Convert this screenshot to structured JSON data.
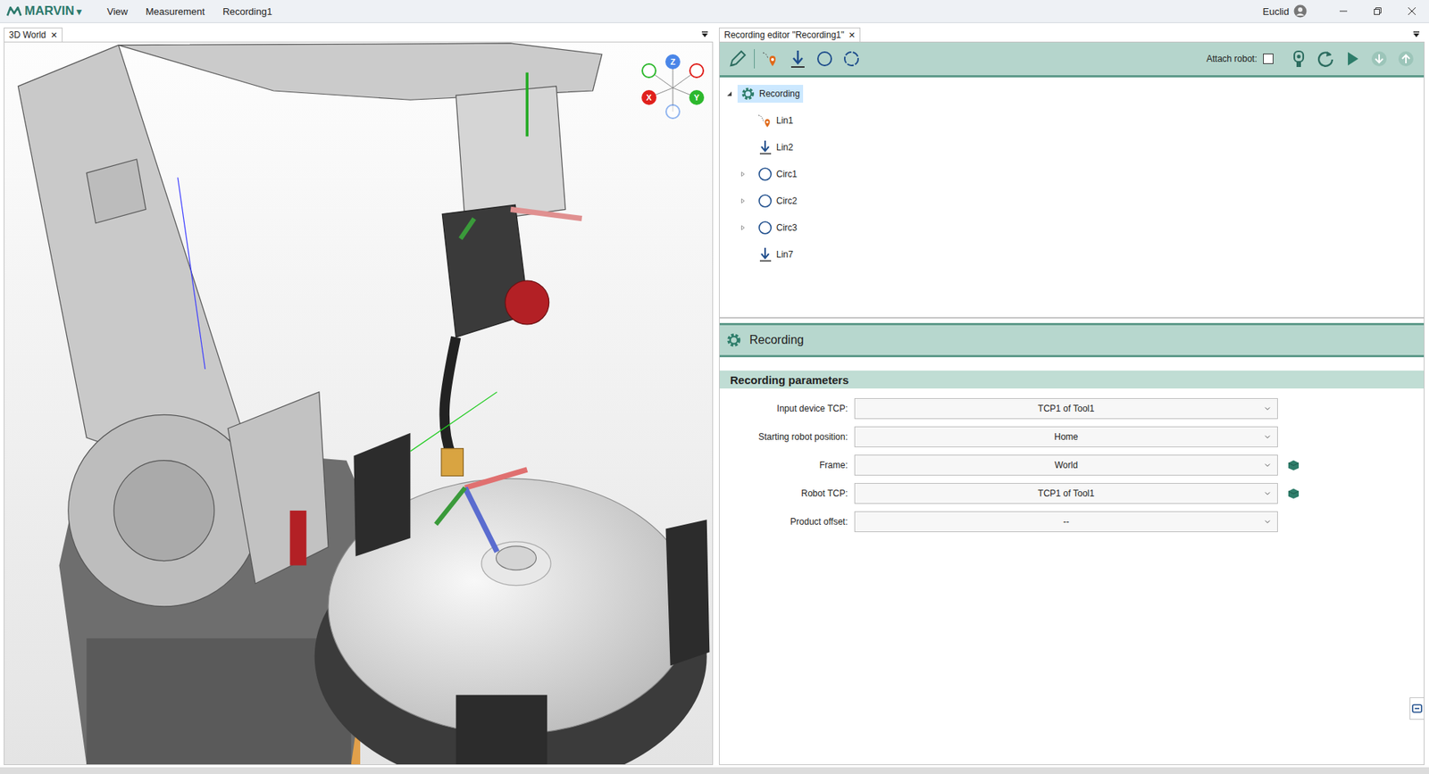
{
  "app": {
    "logo": "MARVIN",
    "logo_caret": "▾",
    "menu": [
      "View",
      "Measurement",
      "Recording1"
    ],
    "user": "Euclid"
  },
  "left_tab": {
    "label": "3D World",
    "close": "✕",
    "selected": true
  },
  "viewport": {
    "gizmo": [
      {
        "label": "Z",
        "color": "#4a86e8"
      },
      {
        "label": "X",
        "color": "#e0201c"
      },
      {
        "label": "Y",
        "color": "#2db82d"
      }
    ]
  },
  "right_tab": {
    "label": "Recording editor \"Recording1\"",
    "close": "✕",
    "selected": true
  },
  "toolbar": {
    "attach_robot": {
      "label": "Attach robot:",
      "checked": false
    }
  },
  "tree": {
    "root": {
      "label": "Recording",
      "expanded": true,
      "selected": true
    },
    "items": [
      {
        "label": "Lin1",
        "kind": "point",
        "expandable": false,
        "expanded": false,
        "selected": false
      },
      {
        "label": "Lin2",
        "kind": "lin",
        "expandable": false,
        "expanded": false,
        "selected": false
      },
      {
        "label": "Circ1",
        "kind": "circ",
        "expandable": true,
        "expanded": false,
        "selected": false
      },
      {
        "label": "Circ2",
        "kind": "circ",
        "expandable": true,
        "expanded": false,
        "selected": false
      },
      {
        "label": "Circ3",
        "kind": "circ",
        "expandable": true,
        "expanded": false,
        "selected": false
      },
      {
        "label": "Lin7",
        "kind": "lin",
        "expandable": false,
        "expanded": false,
        "selected": false
      }
    ]
  },
  "detail": {
    "title": "Recording",
    "section": "Recording parameters",
    "fields": [
      {
        "label": "Input device TCP:",
        "value": "TCP1 of Tool1",
        "has_button": false
      },
      {
        "label": "Starting robot position:",
        "value": "Home",
        "has_button": false
      },
      {
        "label": "Frame:",
        "value": "World",
        "has_button": true
      },
      {
        "label": "Robot TCP:",
        "value": "TCP1 of Tool1",
        "has_button": true
      },
      {
        "label": "Product offset:",
        "value": "--",
        "has_button": false
      }
    ]
  }
}
